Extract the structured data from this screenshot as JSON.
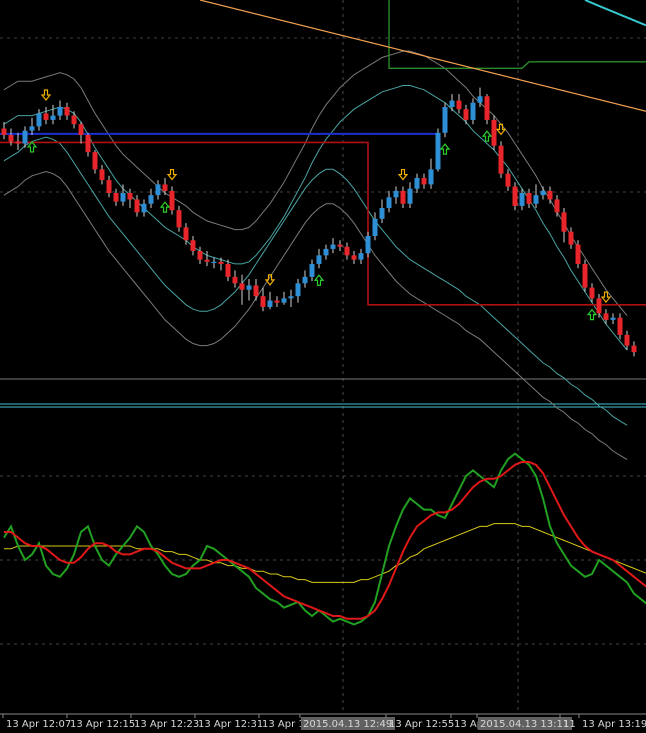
{
  "chart_data": {
    "type": "candlestick",
    "colors": {
      "background": "#000000",
      "bull": "#2f8fd6",
      "bear": "#e8252a",
      "bands": "#4aa3a3",
      "bands_outer": "#7a7a7a",
      "trend_orange": "#f0a050",
      "level_blue": "#1c2fd0",
      "level_red": "#b01010",
      "level_green": "#2a8a2a",
      "cyan": "#35c8d0",
      "separator": "#3fc0d0",
      "osc_fast": "#21a021",
      "osc_slow": "#e01818",
      "osc_signal": "#d8c818",
      "arrow_up": "#2bd02b",
      "arrow_down": "#f0b000",
      "grid": "#9a9a9a"
    },
    "x_ticks": [
      "13 Apr 12:07",
      "13 Apr 12:15",
      "13 Apr 12:23",
      "13 Apr 12:31",
      "13 Apr 12",
      "2015.04.13 12:49",
      "13 Apr 12:55",
      "13 Ap",
      "2015.04.13 13:11",
      "11",
      "13 Apr 13:19"
    ],
    "highlighted_ticks": [
      "2015.04.13 12:49",
      "2015.04.13 13:11"
    ],
    "candles": [
      [
        1.0,
        0.7,
        1.3,
        0.5
      ],
      [
        0.7,
        0.4,
        1.0,
        0.2
      ],
      [
        0.4,
        0.3,
        0.8,
        0.0
      ],
      [
        0.3,
        0.9,
        1.1,
        0.1
      ],
      [
        0.9,
        1.1,
        1.5,
        0.7
      ],
      [
        1.1,
        1.7,
        1.9,
        0.9
      ],
      [
        1.7,
        1.4,
        2.0,
        1.2
      ],
      [
        1.4,
        1.6,
        2.1,
        1.2
      ],
      [
        1.6,
        2.0,
        2.3,
        1.4
      ],
      [
        2.0,
        1.6,
        2.2,
        1.4
      ],
      [
        1.6,
        1.2,
        1.8,
        1.0
      ],
      [
        1.2,
        0.7,
        1.3,
        0.3
      ],
      [
        0.7,
        -0.1,
        0.8,
        -0.3
      ],
      [
        -0.1,
        -0.9,
        0.0,
        -1.1
      ],
      [
        -0.9,
        -1.4,
        -0.7,
        -1.6
      ],
      [
        -1.4,
        -2.0,
        -1.2,
        -2.2
      ],
      [
        -2.0,
        -2.4,
        -1.8,
        -2.6
      ],
      [
        -2.4,
        -2.0,
        -1.6,
        -2.6
      ],
      [
        -2.0,
        -2.3,
        -1.8,
        -2.7
      ],
      [
        -2.3,
        -2.9,
        -2.1,
        -3.1
      ],
      [
        -2.9,
        -2.5,
        -2.3,
        -3.1
      ],
      [
        -2.5,
        -2.1,
        -1.8,
        -2.7
      ],
      [
        -2.1,
        -1.6,
        -1.4,
        -2.3
      ],
      [
        -1.6,
        -1.9,
        -1.3,
        -2.1
      ],
      [
        -1.9,
        -2.8,
        -1.7,
        -3.0
      ],
      [
        -2.8,
        -3.6,
        -2.6,
        -3.8
      ],
      [
        -3.6,
        -4.2,
        -3.4,
        -4.4
      ],
      [
        -4.2,
        -4.7,
        -4.0,
        -4.9
      ],
      [
        -4.7,
        -5.1,
        -4.5,
        -5.3
      ],
      [
        -5.1,
        -5.2,
        -4.7,
        -5.4
      ],
      [
        -5.2,
        -5.2,
        -5.0,
        -5.5
      ],
      [
        -5.2,
        -5.3,
        -5.0,
        -5.6
      ],
      [
        -5.3,
        -5.9,
        -5.1,
        -6.1
      ],
      [
        -5.9,
        -6.2,
        -5.6,
        -6.4
      ],
      [
        -6.2,
        -6.5,
        -5.8,
        -7.2
      ],
      [
        -6.5,
        -6.3,
        -6.0,
        -7.0
      ],
      [
        -6.3,
        -6.8,
        -6.0,
        -7.0
      ],
      [
        -6.8,
        -7.3,
        -6.4,
        -7.5
      ],
      [
        -7.3,
        -7.0,
        -6.6,
        -7.4
      ],
      [
        -7.0,
        -7.1,
        -6.8,
        -7.3
      ],
      [
        -7.1,
        -6.9,
        -6.6,
        -7.2
      ],
      [
        -6.9,
        -6.8,
        -6.5,
        -7.3
      ],
      [
        -6.8,
        -6.2,
        -6.0,
        -7.1
      ],
      [
        -6.2,
        -5.9,
        -5.6,
        -6.4
      ],
      [
        -5.9,
        -5.3,
        -5.1,
        -6.1
      ],
      [
        -5.3,
        -4.9,
        -4.6,
        -5.5
      ],
      [
        -4.9,
        -4.6,
        -4.4,
        -5.1
      ],
      [
        -4.6,
        -4.4,
        -4.1,
        -4.8
      ],
      [
        -4.4,
        -4.5,
        -4.2,
        -4.7
      ],
      [
        -4.5,
        -4.9,
        -4.3,
        -5.1
      ],
      [
        -4.9,
        -5.1,
        -4.7,
        -5.3
      ],
      [
        -5.1,
        -4.8,
        -4.6,
        -5.3
      ],
      [
        -4.8,
        -4.0,
        -3.8,
        -5.0
      ],
      [
        -4.0,
        -3.2,
        -2.9,
        -4.2
      ],
      [
        -3.2,
        -2.7,
        -2.3,
        -3.4
      ],
      [
        -2.7,
        -2.2,
        -1.9,
        -2.9
      ],
      [
        -2.2,
        -1.9,
        -1.7,
        -2.5
      ],
      [
        -1.9,
        -2.5,
        -1.7,
        -2.7
      ],
      [
        -2.5,
        -1.8,
        -1.5,
        -2.7
      ],
      [
        -1.8,
        -1.3,
        -1.1,
        -2.0
      ],
      [
        -1.3,
        -1.6,
        -1.1,
        -1.8
      ],
      [
        -1.6,
        -0.9,
        -0.4,
        -1.8
      ],
      [
        -0.9,
        0.8,
        1.0,
        -1.0
      ],
      [
        0.8,
        2.0,
        2.2,
        0.6
      ],
      [
        2.0,
        2.3,
        2.6,
        1.8
      ],
      [
        2.3,
        1.9,
        2.6,
        1.7
      ],
      [
        1.9,
        1.4,
        2.1,
        1.2
      ],
      [
        1.4,
        2.2,
        2.4,
        1.2
      ],
      [
        2.2,
        2.5,
        2.9,
        2.0
      ],
      [
        2.5,
        1.4,
        2.6,
        1.2
      ],
      [
        1.4,
        0.2,
        1.6,
        0.0
      ],
      [
        0.2,
        -1.1,
        0.4,
        -1.3
      ],
      [
        -1.1,
        -1.7,
        -0.9,
        -1.9
      ],
      [
        -1.7,
        -2.6,
        -1.5,
        -2.8
      ],
      [
        -2.6,
        -2.0,
        -1.8,
        -2.8
      ],
      [
        -2.0,
        -2.5,
        -1.8,
        -2.7
      ],
      [
        -2.5,
        -2.1,
        -1.6,
        -2.7
      ],
      [
        -2.1,
        -1.9,
        -1.7,
        -2.3
      ],
      [
        -1.9,
        -2.3,
        -1.7,
        -2.5
      ],
      [
        -2.3,
        -2.9,
        -2.1,
        -3.1
      ],
      [
        -2.9,
        -3.8,
        -2.7,
        -4.3
      ],
      [
        -3.8,
        -4.4,
        -3.6,
        -4.6
      ],
      [
        -4.4,
        -5.3,
        -4.2,
        -5.5
      ],
      [
        -5.3,
        -6.4,
        -5.1,
        -6.6
      ],
      [
        -6.4,
        -6.9,
        -6.2,
        -7.1
      ],
      [
        -6.9,
        -7.6,
        -6.7,
        -7.8
      ],
      [
        -7.6,
        -7.9,
        -7.4,
        -8.1
      ],
      [
        -7.9,
        -7.8,
        -7.6,
        -8.1
      ],
      [
        -7.8,
        -8.6,
        -7.6,
        -8.8
      ],
      [
        -8.6,
        -9.1,
        -8.4,
        -9.3
      ],
      [
        -9.1,
        -9.4,
        -8.9,
        -9.6
      ]
    ],
    "upper_band": [
      1.2,
      1.4,
      1.6,
      1.6,
      1.6,
      1.7,
      1.8,
      1.9,
      2.0,
      1.9,
      1.7,
      1.3,
      0.7,
      0.1,
      -0.4,
      -0.9,
      -1.4,
      -1.8,
      -2.1,
      -2.4,
      -2.7,
      -3.0,
      -3.3,
      -3.6,
      -3.8,
      -4.0,
      -4.2,
      -4.5,
      -4.7,
      -4.9,
      -5.0,
      -5.1,
      -5.2,
      -5.3,
      -5.3,
      -5.2,
      -4.9,
      -4.5,
      -4.1,
      -3.6,
      -3.1,
      -2.5,
      -1.9,
      -1.3,
      -0.6,
      0.0,
      0.5,
      0.9,
      1.3,
      1.6,
      1.9,
      2.1,
      2.3,
      2.5,
      2.7,
      2.8,
      2.9,
      3.0,
      3.0,
      2.9,
      2.8,
      2.6,
      2.4,
      2.2,
      1.9,
      1.6,
      1.3,
      0.9,
      0.6,
      0.3,
      0.0,
      -0.4,
      -0.8,
      -1.3,
      -1.8,
      -2.3,
      -2.8,
      -3.4,
      -3.9,
      -4.5,
      -5.0,
      -5.6,
      -6.1,
      -6.6,
      -7.1,
      -7.6,
      -8.1,
      -8.5,
      -8.9,
      -9.3
    ],
    "lower_band": [
      -0.5,
      -0.3,
      -0.1,
      0.2,
      0.4,
      0.5,
      0.6,
      0.5,
      0.3,
      -0.1,
      -0.6,
      -1.1,
      -1.6,
      -2.1,
      -2.6,
      -3.1,
      -3.5,
      -3.9,
      -4.3,
      -4.7,
      -5.1,
      -5.5,
      -5.9,
      -6.3,
      -6.6,
      -6.9,
      -7.2,
      -7.4,
      -7.5,
      -7.5,
      -7.4,
      -7.2,
      -6.9,
      -6.6,
      -6.2,
      -5.8,
      -5.3,
      -4.8,
      -4.3,
      -3.8,
      -3.3,
      -2.8,
      -2.3,
      -1.8,
      -1.4,
      -1.1,
      -0.9,
      -0.9,
      -1.1,
      -1.4,
      -1.8,
      -2.3,
      -2.8,
      -3.3,
      -3.7,
      -4.1,
      -4.5,
      -4.8,
      -5.1,
      -5.3,
      -5.5,
      -5.7,
      -5.9,
      -6.1,
      -6.3,
      -6.5,
      -6.8,
      -7.0,
      -7.2,
      -7.5,
      -7.8,
      -8.1,
      -8.4,
      -8.7,
      -9.0,
      -9.3,
      -9.6,
      -9.9,
      -10.1,
      -10.4,
      -10.6,
      -10.9,
      -11.1,
      -11.4,
      -11.6,
      -11.9,
      -12.1,
      -12.4,
      -12.6,
      -12.8
    ],
    "oscillator": {
      "fast": [
        58,
        62,
        55,
        50,
        52,
        56,
        48,
        45,
        44,
        47,
        52,
        60,
        62,
        55,
        50,
        48,
        52,
        55,
        58,
        62,
        60,
        55,
        52,
        48,
        45,
        44,
        45,
        48,
        50,
        55,
        54,
        52,
        50,
        48,
        46,
        44,
        40,
        38,
        36,
        35,
        33,
        34,
        35,
        32,
        30,
        32,
        30,
        28,
        29,
        28,
        27,
        28,
        30,
        35,
        45,
        55,
        62,
        68,
        72,
        70,
        68,
        68,
        66,
        65,
        70,
        75,
        80,
        82,
        80,
        78,
        76,
        82,
        86,
        88,
        86,
        84,
        80,
        72,
        62,
        56,
        52,
        48,
        46,
        44,
        45,
        50,
        48,
        46,
        44,
        42,
        38,
        36,
        34,
        33,
        32,
        30
      ],
      "slow": [
        60,
        60,
        58,
        56,
        55,
        55,
        54,
        52,
        50,
        49,
        49,
        51,
        54,
        56,
        56,
        55,
        53,
        52,
        52,
        53,
        54,
        54,
        53,
        51,
        49,
        48,
        47,
        47,
        47,
        48,
        49,
        50,
        50,
        49,
        48,
        47,
        45,
        43,
        41,
        39,
        37,
        36,
        35,
        34,
        33,
        32,
        31,
        30,
        30,
        29,
        29,
        29,
        30,
        32,
        36,
        41,
        47,
        53,
        58,
        62,
        64,
        66,
        67,
        67,
        68,
        70,
        73,
        76,
        78,
        79,
        79,
        80,
        82,
        84,
        85,
        85,
        84,
        81,
        76,
        71,
        66,
        62,
        58,
        55,
        53,
        52,
        51,
        50,
        48,
        46,
        44,
        42,
        40,
        38,
        37,
        35
      ],
      "signal": [
        54,
        54,
        55,
        55,
        55,
        55,
        55,
        55,
        55,
        55,
        55,
        55,
        55,
        55,
        55,
        55,
        55,
        55,
        55,
        54,
        54,
        54,
        54,
        53,
        53,
        52,
        52,
        51,
        50,
        50,
        49,
        49,
        48,
        48,
        47,
        47,
        46,
        46,
        45,
        45,
        44,
        44,
        43,
        43,
        42,
        42,
        42,
        42,
        42,
        42,
        42,
        43,
        43,
        44,
        45,
        46,
        48,
        49,
        51,
        52,
        54,
        55,
        56,
        57,
        58,
        59,
        60,
        61,
        62,
        62,
        63,
        63,
        63,
        63,
        62,
        62,
        61,
        60,
        59,
        58,
        57,
        56,
        55,
        54,
        53,
        52,
        51,
        50,
        49,
        48,
        47,
        46,
        45,
        44,
        43,
        42
      ]
    },
    "oscillator_levels": [
      80,
      50,
      20
    ],
    "arrows_up": [
      4,
      23,
      45,
      63,
      69,
      84
    ],
    "arrows_down": [
      6,
      24,
      38,
      57,
      71,
      86
    ]
  }
}
